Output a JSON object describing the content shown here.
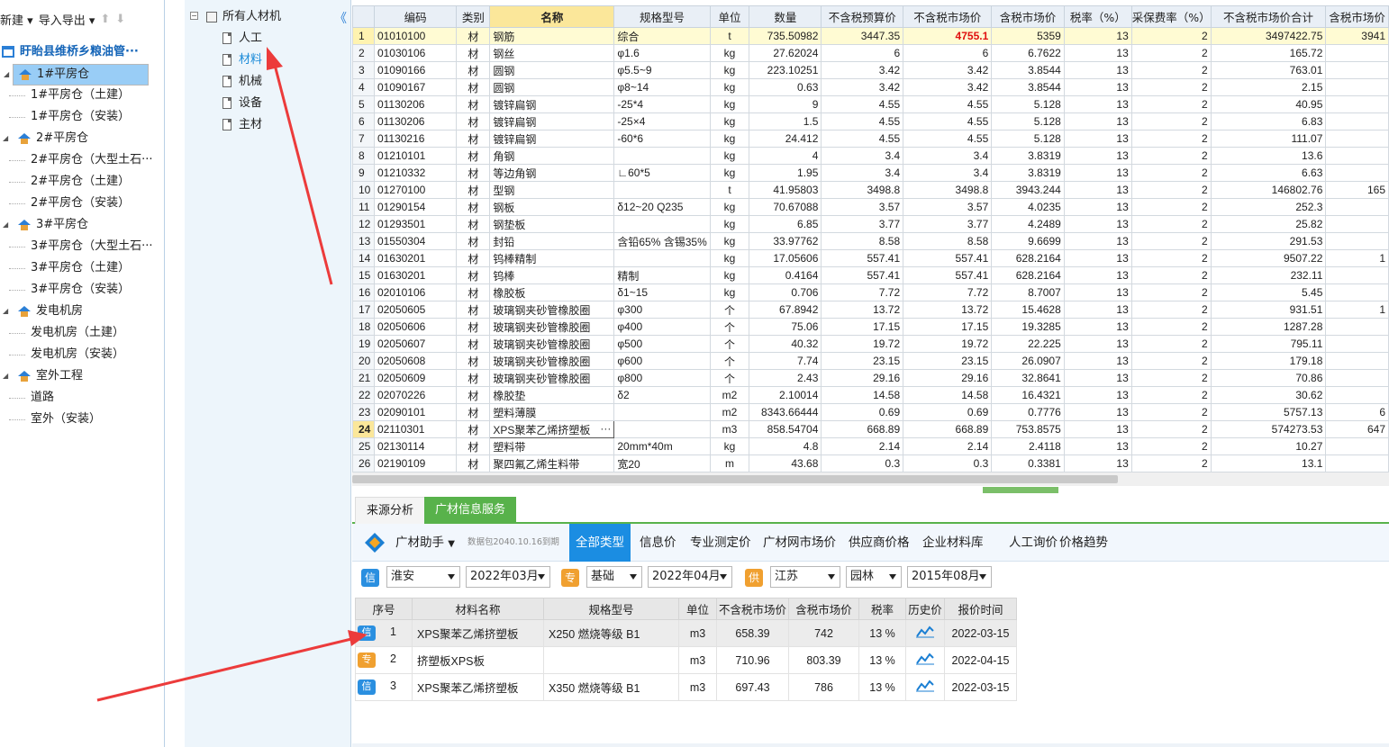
{
  "toolbar": {
    "new_label": "新建",
    "import_export_label": "导入导出"
  },
  "project": {
    "title": "盱眙县维桥乡粮油管···"
  },
  "left_tree": [
    {
      "label": "1#平房仓",
      "level": 1,
      "selected": true
    },
    {
      "label": "1#平房仓（土建）",
      "level": 2
    },
    {
      "label": "1#平房仓（安装）",
      "level": 2
    },
    {
      "label": "2#平房仓",
      "level": 1
    },
    {
      "label": "2#平房仓（大型土石···",
      "level": 2
    },
    {
      "label": "2#平房仓（土建）",
      "level": 2
    },
    {
      "label": "2#平房仓（安装）",
      "level": 2
    },
    {
      "label": "3#平房仓",
      "level": 1
    },
    {
      "label": "3#平房仓（大型土石···",
      "level": 2
    },
    {
      "label": "3#平房仓（土建）",
      "level": 2
    },
    {
      "label": "3#平房仓（安装）",
      "level": 2
    },
    {
      "label": "发电机房",
      "level": 1
    },
    {
      "label": "发电机房（土建）",
      "level": 2
    },
    {
      "label": "发电机房（安装）",
      "level": 2
    },
    {
      "label": "室外工程",
      "level": 1
    },
    {
      "label": "道路",
      "level": 2
    },
    {
      "label": "室外（安装）",
      "level": 2
    }
  ],
  "mid_tree": {
    "root": "所有人材机",
    "collapse_glyph": "《",
    "items": [
      "人工",
      "材料",
      "机械",
      "设备",
      "主材"
    ],
    "active_color": "#1a8ad8"
  },
  "grid": {
    "columns": [
      "",
      "编码",
      "类别",
      "名称",
      "规格型号",
      "单位",
      "数量",
      "不含税预算价",
      "不含税市场价",
      "含税市场价",
      "税率（%）",
      "采保费率（%）",
      "不含税市场价合计",
      "含税市场价"
    ],
    "rows": [
      [
        "1",
        "01010100",
        "材",
        "钢筋",
        "综合",
        "t",
        "735.50982",
        "3447.35",
        "4755.1",
        "5359",
        "13",
        "2",
        "3497422.75",
        "3941"
      ],
      [
        "2",
        "01030106",
        "材",
        "钢丝",
        "φ1.6",
        "kg",
        "27.62024",
        "6",
        "6",
        "6.7622",
        "13",
        "2",
        "165.72",
        ""
      ],
      [
        "3",
        "01090166",
        "材",
        "圆钢",
        "φ5.5~9",
        "kg",
        "223.10251",
        "3.42",
        "3.42",
        "3.8544",
        "13",
        "2",
        "763.01",
        ""
      ],
      [
        "4",
        "01090167",
        "材",
        "圆钢",
        "φ8~14",
        "kg",
        "0.63",
        "3.42",
        "3.42",
        "3.8544",
        "13",
        "2",
        "2.15",
        ""
      ],
      [
        "5",
        "01130206",
        "材",
        "镀锌扁钢",
        "-25*4",
        "kg",
        "9",
        "4.55",
        "4.55",
        "5.128",
        "13",
        "2",
        "40.95",
        ""
      ],
      [
        "6",
        "01130206",
        "材",
        "镀锌扁钢",
        "-25×4",
        "kg",
        "1.5",
        "4.55",
        "4.55",
        "5.128",
        "13",
        "2",
        "6.83",
        ""
      ],
      [
        "7",
        "01130216",
        "材",
        "镀锌扁钢",
        "-60*6",
        "kg",
        "24.412",
        "4.55",
        "4.55",
        "5.128",
        "13",
        "2",
        "111.07",
        ""
      ],
      [
        "8",
        "01210101",
        "材",
        "角钢",
        "",
        "kg",
        "4",
        "3.4",
        "3.4",
        "3.8319",
        "13",
        "2",
        "13.6",
        ""
      ],
      [
        "9",
        "01210332",
        "材",
        "等边角钢",
        "∟60*5",
        "kg",
        "1.95",
        "3.4",
        "3.4",
        "3.8319",
        "13",
        "2",
        "6.63",
        ""
      ],
      [
        "10",
        "01270100",
        "材",
        "型钢",
        "",
        "t",
        "41.95803",
        "3498.8",
        "3498.8",
        "3943.244",
        "13",
        "2",
        "146802.76",
        "165"
      ],
      [
        "11",
        "01290154",
        "材",
        "钢板",
        "δ12~20 Q235",
        "kg",
        "70.67088",
        "3.57",
        "3.57",
        "4.0235",
        "13",
        "2",
        "252.3",
        ""
      ],
      [
        "12",
        "01293501",
        "材",
        "钢垫板",
        "",
        "kg",
        "6.85",
        "3.77",
        "3.77",
        "4.2489",
        "13",
        "2",
        "25.82",
        ""
      ],
      [
        "13",
        "01550304",
        "材",
        "封铅",
        "含铅65% 含锡35%",
        "kg",
        "33.97762",
        "8.58",
        "8.58",
        "9.6699",
        "13",
        "2",
        "291.53",
        ""
      ],
      [
        "14",
        "01630201",
        "材",
        "钨棒精制",
        "",
        "kg",
        "17.05606",
        "557.41",
        "557.41",
        "628.2164",
        "13",
        "2",
        "9507.22",
        "1"
      ],
      [
        "15",
        "01630201",
        "材",
        "钨棒",
        "精制",
        "kg",
        "0.4164",
        "557.41",
        "557.41",
        "628.2164",
        "13",
        "2",
        "232.11",
        ""
      ],
      [
        "16",
        "02010106",
        "材",
        "橡胶板",
        "δ1~15",
        "kg",
        "0.706",
        "7.72",
        "7.72",
        "8.7007",
        "13",
        "2",
        "5.45",
        ""
      ],
      [
        "17",
        "02050605",
        "材",
        "玻璃钢夹砂管橡胶圈",
        "φ300",
        "个",
        "67.8942",
        "13.72",
        "13.72",
        "15.4628",
        "13",
        "2",
        "931.51",
        "1"
      ],
      [
        "18",
        "02050606",
        "材",
        "玻璃钢夹砂管橡胶圈",
        "φ400",
        "个",
        "75.06",
        "17.15",
        "17.15",
        "19.3285",
        "13",
        "2",
        "1287.28",
        ""
      ],
      [
        "19",
        "02050607",
        "材",
        "玻璃钢夹砂管橡胶圈",
        "φ500",
        "个",
        "40.32",
        "19.72",
        "19.72",
        "22.225",
        "13",
        "2",
        "795.11",
        ""
      ],
      [
        "20",
        "02050608",
        "材",
        "玻璃钢夹砂管橡胶圈",
        "φ600",
        "个",
        "7.74",
        "23.15",
        "23.15",
        "26.0907",
        "13",
        "2",
        "179.18",
        ""
      ],
      [
        "21",
        "02050609",
        "材",
        "玻璃钢夹砂管橡胶圈",
        "φ800",
        "个",
        "2.43",
        "29.16",
        "29.16",
        "32.8641",
        "13",
        "2",
        "70.86",
        ""
      ],
      [
        "22",
        "02070226",
        "材",
        "橡胶垫",
        "δ2",
        "m2",
        "2.10014",
        "14.58",
        "14.58",
        "16.4321",
        "13",
        "2",
        "30.62",
        ""
      ],
      [
        "23",
        "02090101",
        "材",
        "塑料薄膜",
        "",
        "m2",
        "8343.66444",
        "0.69",
        "0.69",
        "0.7776",
        "13",
        "2",
        "5757.13",
        "6"
      ],
      [
        "24",
        "02110301",
        "材",
        "XPS聚苯乙烯挤塑板",
        "",
        "m3",
        "858.54704",
        "668.89",
        "668.89",
        "753.8575",
        "13",
        "2",
        "574273.53",
        "647"
      ],
      [
        "25",
        "02130114",
        "材",
        "塑料带",
        "20mm*40m",
        "kg",
        "4.8",
        "2.14",
        "2.14",
        "2.4118",
        "13",
        "2",
        "10.27",
        ""
      ],
      [
        "26",
        "02190109",
        "材",
        "聚四氟乙烯生料带",
        "宽20",
        "m",
        "43.68",
        "0.3",
        "0.3",
        "0.3381",
        "13",
        "2",
        "13.1",
        ""
      ]
    ],
    "current_row_ellipsis": "···"
  },
  "bottom_tabs": [
    "来源分析",
    "广材信息服务"
  ],
  "service_bar": {
    "assistant_label": "广材助手",
    "data_note": "数据包2040.10.16到期",
    "tabs": [
      "全部类型",
      "信息价",
      "专业测定价",
      "广材网市场价",
      "供应商价格",
      "企业材料库",
      "人工询价",
      "价格趋势"
    ]
  },
  "filters": {
    "badge1": "信",
    "city": "淮安",
    "period1": "2022年03月",
    "badge2": "专",
    "category": "基础",
    "period2": "2022年04月",
    "badge3": "供",
    "province": "江苏",
    "type": "园林",
    "period3": "2015年08月",
    "badge_colors": {
      "info": "#2a8fe0",
      "pro": "#f0a030",
      "supply": "#f0a030"
    }
  },
  "price_table": {
    "columns": [
      "序号",
      "材料名称",
      "规格型号",
      "单位",
      "不含税市场价",
      "含税市场价",
      "税率",
      "历史价",
      "报价时间"
    ],
    "rows": [
      {
        "badge": "信",
        "badge_color": "#2a8fe0",
        "no": "1",
        "name": "XPS聚苯乙烯挤塑板",
        "spec": "X250 燃烧等级 B1",
        "unit": "m3",
        "price_ex": "658.39",
        "price_in": "742",
        "tax": "13 %",
        "time": "2022-03-15"
      },
      {
        "badge": "专",
        "badge_color": "#f0a030",
        "no": "2",
        "name": "挤塑板XPS板",
        "spec": "",
        "unit": "m3",
        "price_ex": "710.96",
        "price_in": "803.39",
        "tax": "13 %",
        "time": "2022-04-15"
      },
      {
        "badge": "信",
        "badge_color": "#2a8fe0",
        "no": "3",
        "name": "XPS聚苯乙烯挤塑板",
        "spec": "X350 燃烧等级 B1",
        "unit": "m3",
        "price_ex": "697.43",
        "price_in": "786",
        "tax": "13 %",
        "time": "2022-03-15"
      }
    ]
  },
  "annotation_color": "#ec3b3b"
}
